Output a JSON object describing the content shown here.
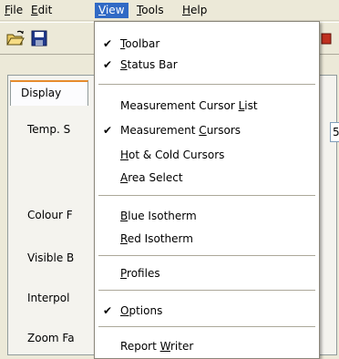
{
  "menubar": {
    "items": [
      {
        "label": "File",
        "accel_index": 0
      },
      {
        "label": "Edit",
        "accel_index": 0
      },
      {
        "label": "View",
        "accel_index": 0
      },
      {
        "label": "Tools",
        "accel_index": 0
      },
      {
        "label": "Help",
        "accel_index": 0
      }
    ]
  },
  "panel": {
    "tab_label": "Display",
    "labels": [
      "Temp. S",
      "Colour F",
      "Visible B",
      "Interpol",
      "Zoom Fa"
    ],
    "field_value": "5"
  },
  "view_menu": {
    "items": [
      {
        "label": "Toolbar",
        "checked": true,
        "accel_index": 0
      },
      {
        "label": "Status Bar",
        "checked": true,
        "accel_index": 0
      },
      {
        "label": "Measurement Cursor List",
        "checked": false,
        "accel_index": 19
      },
      {
        "label": "Measurement Cursors",
        "checked": true,
        "accel_index": 12
      },
      {
        "label": "Hot & Cold Cursors",
        "checked": false,
        "accel_index": 0
      },
      {
        "label": "Area Select",
        "checked": false,
        "accel_index": 0
      },
      {
        "label": "Blue Isotherm",
        "checked": false,
        "accel_index": 0
      },
      {
        "label": "Red Isotherm",
        "checked": false,
        "accel_index": 0
      },
      {
        "label": "Profiles",
        "checked": false,
        "accel_index": 0
      },
      {
        "label": "Options",
        "checked": true,
        "accel_index": 0
      },
      {
        "label": "Report Writer",
        "checked": false,
        "accel_index": 7
      }
    ],
    "check_glyph": "✔"
  },
  "colors": {
    "menu_highlight": "#316ac5",
    "tab_accent": "#e68b2c"
  }
}
